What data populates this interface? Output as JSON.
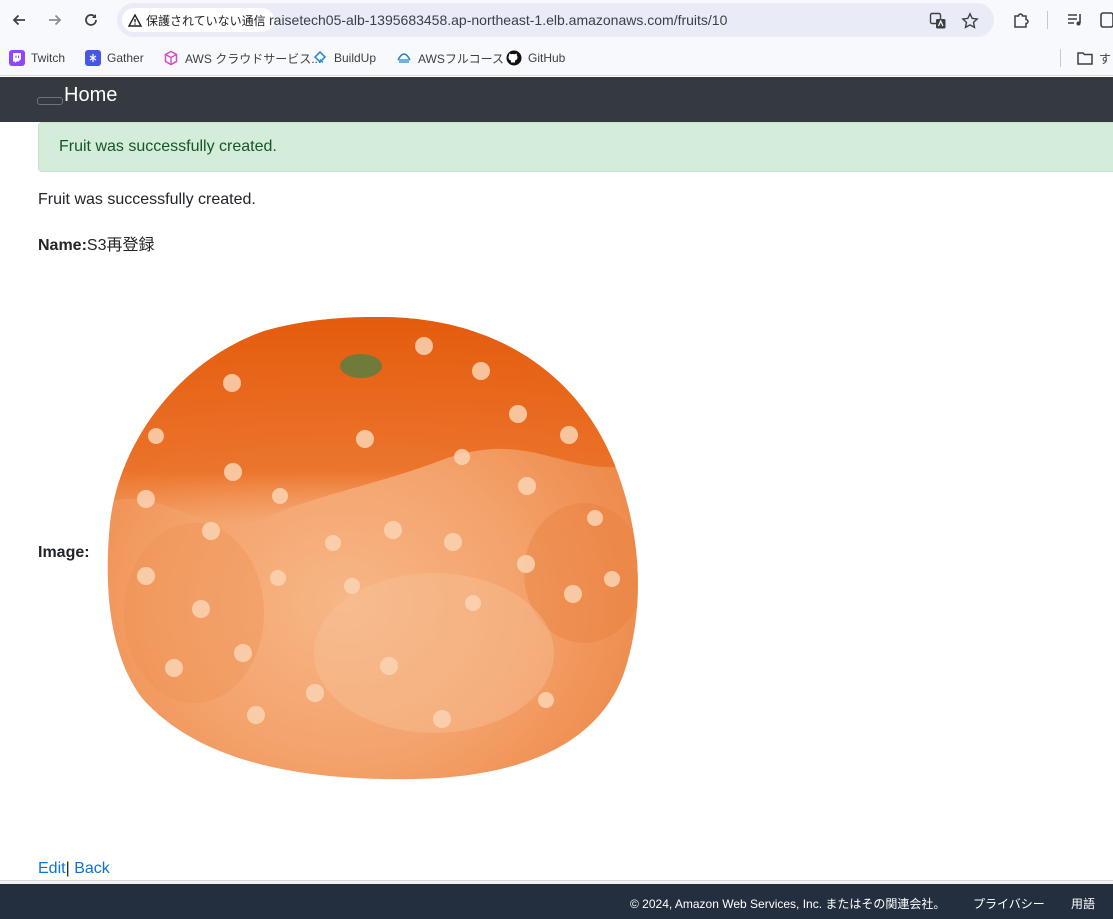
{
  "browser": {
    "security_label": "保護されていない通信",
    "url": "raisetech05-alb-1395683458.ap-northeast-1.elb.amazonaws.com/fruits/10",
    "bookmarks": [
      {
        "label": "Twitch",
        "icon": "twitch-icon",
        "color": "#9146ff"
      },
      {
        "label": "Gather",
        "icon": "gather-icon",
        "color": "#4557e8"
      },
      {
        "label": "AWS クラウドサービス...",
        "icon": "aws-cube-icon",
        "color": "#d24cc3"
      },
      {
        "label": "BuildUp",
        "icon": "buildup-icon",
        "color": "#2b8de0"
      },
      {
        "label": "AWSフルコース",
        "icon": "aws-course-icon",
        "color": "#2f7fb8"
      },
      {
        "label": "GitHub",
        "icon": "github-icon",
        "color": "#111111"
      }
    ],
    "folder_label": "す"
  },
  "page": {
    "brand": "Home",
    "flash": "Fruit was successfully created.",
    "notice": "Fruit was successfully created.",
    "name_label": "Name:",
    "name_value": "S3再登録",
    "image_label": "Image:",
    "image_subject": "mandarin-orange-illustration",
    "edit_link": "Edit",
    "separator": "|",
    "back_link": "Back"
  },
  "footer": {
    "copyright": "© 2024, Amazon Web Services, Inc. またはその関連会社。",
    "privacy": "プライバシー",
    "terms": "用語"
  },
  "colors": {
    "navbar": "#343a40",
    "alert_bg": "#d4edda",
    "alert_text": "#155724",
    "link": "#0b73d8",
    "footer_bg": "#232f3e"
  }
}
